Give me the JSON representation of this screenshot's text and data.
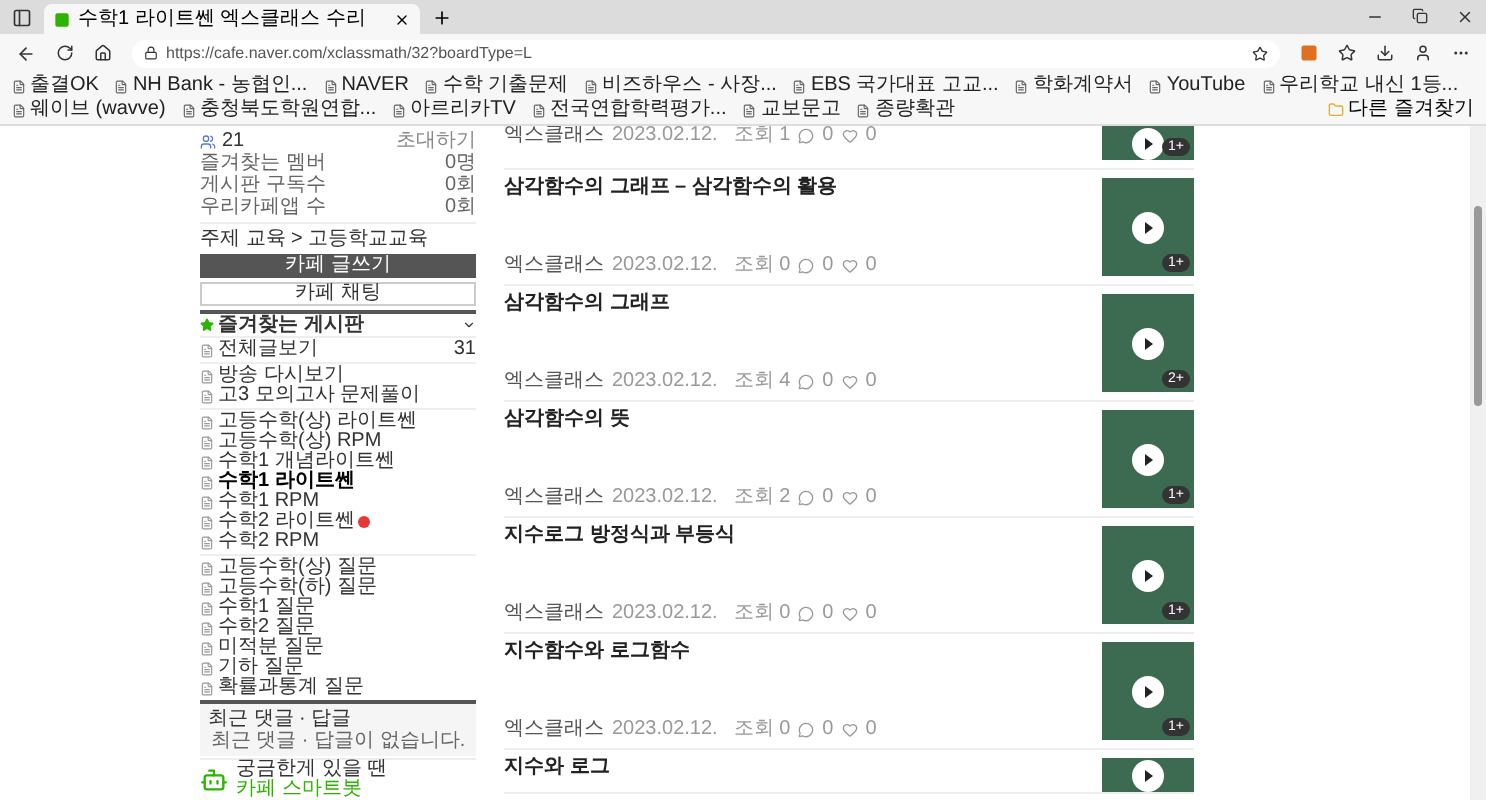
{
  "browser": {
    "tab_title": "수학1 라이트쎈 엑스클래스 수리",
    "url": "https://cafe.naver.com/xclassmath/32?boardType=L",
    "bookmarks": [
      {
        "label": "출결OK"
      },
      {
        "label": "NH Bank - 농협인..."
      },
      {
        "label": "NAVER"
      },
      {
        "label": "수학 기출문제"
      },
      {
        "label": "비즈하우스 - 사장..."
      },
      {
        "label": "EBS 국가대표 고교..."
      },
      {
        "label": "학화계약서"
      },
      {
        "label": "YouTube"
      },
      {
        "label": "우리학교 내신 1등..."
      },
      {
        "label": "웨이브 (wavve)"
      },
      {
        "label": "충청북도학원연합..."
      },
      {
        "label": "아르리카TV"
      },
      {
        "label": "전국연합학력평가..."
      },
      {
        "label": "교보문고"
      },
      {
        "label": "종량확관"
      }
    ],
    "other_bookmarks": "다른 즐겨찾기"
  },
  "sidebar": {
    "member_count": "21",
    "invite": "초대하기",
    "stats": [
      {
        "label": "즐겨찾는 멤버",
        "value": "0명"
      },
      {
        "label": "게시판 구독수",
        "value": "0회"
      },
      {
        "label": "우리카페앱 수",
        "value": "0회"
      }
    ],
    "breadcrumb": "주제 교육 > 고등학교교육",
    "write_button": "카페 글쓰기",
    "chat_button": "카페 채팅",
    "favorites_title": "즐겨찾는 게시판",
    "board_groups": [
      [
        {
          "label": "전체글보기",
          "count": "31",
          "selected": false,
          "new": false
        }
      ],
      [
        {
          "label": "방송 다시보기",
          "selected": false,
          "new": false
        },
        {
          "label": "고3 모의고사 문제풀이",
          "selected": false,
          "new": false
        }
      ],
      [
        {
          "label": "고등수학(상) 라이트쎈",
          "selected": false,
          "new": false
        },
        {
          "label": "고등수학(상) RPM",
          "selected": false,
          "new": false
        },
        {
          "label": "수학1 개념라이트쎈",
          "selected": false,
          "new": false
        },
        {
          "label": "수학1 라이트쎈",
          "selected": true,
          "new": false
        },
        {
          "label": "수학1 RPM",
          "selected": false,
          "new": false
        },
        {
          "label": "수학2 라이트쎈",
          "selected": false,
          "new": true
        },
        {
          "label": "수학2 RPM",
          "selected": false,
          "new": false
        }
      ],
      [
        {
          "label": "고등수학(상) 질문",
          "selected": false,
          "new": false
        },
        {
          "label": "고등수학(하) 질문",
          "selected": false,
          "new": false
        },
        {
          "label": "수학1 질문",
          "selected": false,
          "new": false
        },
        {
          "label": "수학2 질문",
          "selected": false,
          "new": false
        },
        {
          "label": "미적분 질문",
          "selected": false,
          "new": false
        },
        {
          "label": "기하 질문",
          "selected": false,
          "new": false
        },
        {
          "label": "확률과통계 질문",
          "selected": false,
          "new": false
        }
      ]
    ],
    "recent": {
      "title": "최근 댓글 · 답글",
      "empty": "최근 댓글 · 답글이 없습니다."
    },
    "bot": {
      "line1": "궁금한게 있을 땐",
      "line2": "카페 스마트봇"
    }
  },
  "posts": [
    {
      "author": "엑스클래스",
      "date": "2023.02.12.",
      "views": "조회 1",
      "comments": "0",
      "likes": "0",
      "badge": "1+"
    },
    {
      "title": "삼각함수의 그래프 – 삼각함수의 활용",
      "author": "엑스클래스",
      "date": "2023.02.12.",
      "views": "조회 0",
      "comments": "0",
      "likes": "0",
      "badge": "1+"
    },
    {
      "title": "삼각함수의 그래프",
      "author": "엑스클래스",
      "date": "2023.02.12.",
      "views": "조회 4",
      "comments": "0",
      "likes": "0",
      "badge": "2+"
    },
    {
      "title": "삼각함수의 뜻",
      "author": "엑스클래스",
      "date": "2023.02.12.",
      "views": "조회 2",
      "comments": "0",
      "likes": "0",
      "badge": "1+"
    },
    {
      "title": "지수로그 방정식과 부등식",
      "author": "엑스클래스",
      "date": "2023.02.12.",
      "views": "조회 0",
      "comments": "0",
      "likes": "0",
      "badge": "1+"
    },
    {
      "title": "지수함수와 로그함수",
      "author": "엑스클래스",
      "date": "2023.02.12.",
      "views": "조회 0",
      "comments": "0",
      "likes": "0",
      "badge": "1+"
    },
    {
      "title": "지수와 로그"
    }
  ]
}
